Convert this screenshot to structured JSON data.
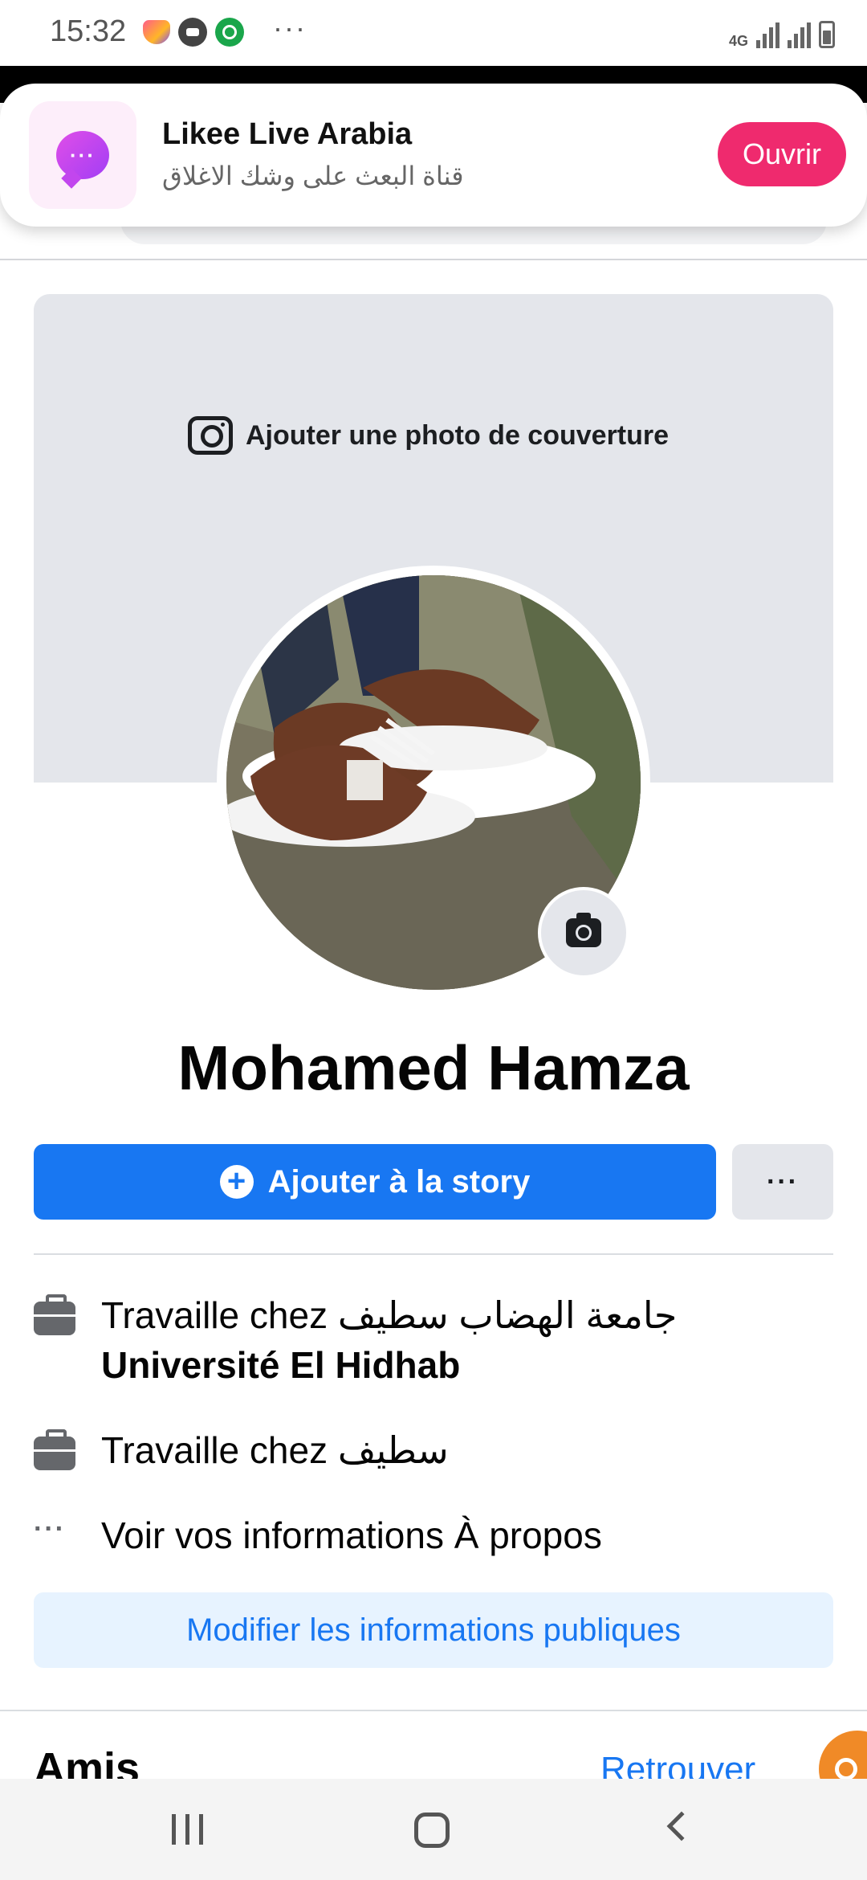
{
  "status_bar": {
    "time": "15:32",
    "more": "···",
    "network": "4G",
    "icons": [
      "heart-app-icon",
      "chat-bubble-icon",
      "location-icon",
      "signal-icon",
      "battery-icon"
    ]
  },
  "notification": {
    "app_name": "Likee Live Arabia",
    "message": "قناة البعث على وشك الاغلاق",
    "open_label": "Ouvrir",
    "accent": "#ef2a6e"
  },
  "cover": {
    "add_label": "Ajouter une photo de couverture"
  },
  "profile": {
    "name": "Mohamed Hamza"
  },
  "actions": {
    "story_label": "Ajouter à la story",
    "more_label": "···",
    "primary_color": "#1877f2"
  },
  "info": {
    "work1_prefix": "Travaille chez جامعة الهضاب سطيف",
    "work1_bold": "Université El Hidhab",
    "work2": "Travaille chez سطيف",
    "about": "Voir vos informations À propos",
    "edit_public": "Modifier les informations publiques"
  },
  "friends": {
    "title": "Amis",
    "find_label": "Retrouver"
  }
}
